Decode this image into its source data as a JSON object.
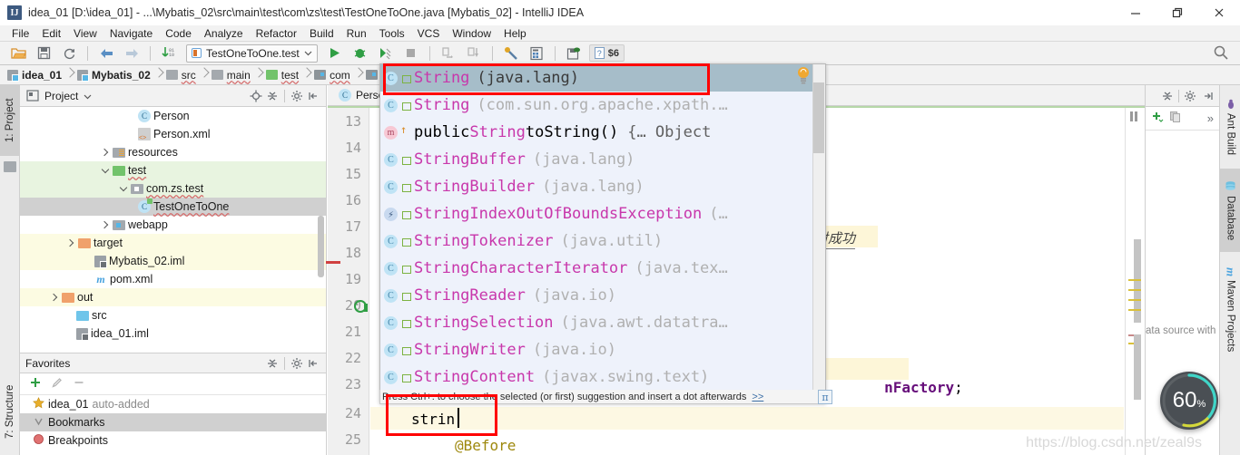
{
  "window": {
    "title": "idea_01 [D:\\idea_01] - ...\\Mybatis_02\\src\\main\\test\\com\\zs\\test\\TestOneToOne.java [Mybatis_02] - IntelliJ IDEA",
    "logo_text": "IJ",
    "minimize_label": "minimize",
    "maximize_label": "restore",
    "close_label": "close"
  },
  "menubar": {
    "items": [
      "File",
      "Edit",
      "View",
      "Navigate",
      "Code",
      "Analyze",
      "Refactor",
      "Build",
      "Run",
      "Tools",
      "VCS",
      "Window",
      "Help"
    ]
  },
  "toolbar": {
    "icons": [
      {
        "name": "open-project-icon"
      },
      {
        "name": "save-all-icon"
      },
      {
        "name": "sync-icon"
      },
      {
        "name": "back-icon"
      },
      {
        "name": "forward-icon"
      },
      {
        "name": "update-project-icon"
      }
    ],
    "run_config": "TestOneToOne.test",
    "run_icons": [
      {
        "name": "run-icon"
      },
      {
        "name": "debug-icon"
      },
      {
        "name": "run-with-coverage-icon"
      },
      {
        "name": "stop-icon"
      },
      {
        "name": "step-over-icon"
      },
      {
        "name": "step-into-icon"
      },
      {
        "name": "settings-wrench-icon"
      },
      {
        "name": "project-structure-icon"
      },
      {
        "name": "save-db-icon"
      }
    ],
    "help_badge": "$6",
    "search_label": "search-everywhere"
  },
  "navbar": {
    "crumbs": [
      {
        "label": "idea_01",
        "kind": "module",
        "bold": true,
        "spell": false
      },
      {
        "label": "Mybatis_02",
        "kind": "module",
        "bold": true,
        "spell": false
      },
      {
        "label": "src",
        "kind": "folder-gray",
        "bold": false,
        "spell": true
      },
      {
        "label": "main",
        "kind": "folder-gray",
        "bold": false,
        "spell": true
      },
      {
        "label": "test",
        "kind": "folder-green",
        "bold": false,
        "spell": true
      },
      {
        "label": "com",
        "kind": "folder-gray",
        "bold": false,
        "spell": true
      },
      {
        "label": "",
        "kind": "folder-blue",
        "bold": false,
        "spell": false
      }
    ]
  },
  "left_tabs": [
    {
      "label": "1: Project",
      "selected": true
    },
    {
      "label": "7: Structure",
      "selected": false
    }
  ],
  "right_tabs": [
    {
      "label": "Ant Build",
      "icon": "ant-icon",
      "selected": false
    },
    {
      "label": "Database",
      "icon": "database-icon",
      "selected": true
    },
    {
      "label": "Maven Projects",
      "icon": "maven-m-icon",
      "selected": false
    }
  ],
  "project_panel": {
    "title": "Project",
    "actions": [
      "locate-icon",
      "collapse-all-icon",
      "gear-icon",
      "hide-icon"
    ],
    "tree": [
      {
        "label": "Person",
        "icon": "class-icon",
        "indent": 7,
        "twist": "none",
        "row": "normal",
        "spell": false
      },
      {
        "label": "Person.xml",
        "icon": "xml-icon",
        "indent": 7,
        "twist": "none",
        "row": "normal",
        "spell": false
      },
      {
        "label": "resources",
        "icon": "resources-folder-icon",
        "indent": 4,
        "twist": "closed",
        "row": "normal",
        "spell": false
      },
      {
        "label": "test",
        "icon": "folder-green-icon",
        "indent": 4,
        "twist": "open",
        "row": "green",
        "spell": true
      },
      {
        "label": "com.zs.test",
        "icon": "package-icon",
        "indent": 5,
        "twist": "open",
        "row": "green",
        "spell": true
      },
      {
        "label": "TestOneToOne",
        "icon": "test-class-icon",
        "indent": 7,
        "twist": "none",
        "row": "selected",
        "spell": true
      },
      {
        "label": "webapp",
        "icon": "web-folder-icon",
        "indent": 4,
        "twist": "closed",
        "row": "normal",
        "spell": false
      },
      {
        "label": "target",
        "icon": "folder-orange-icon",
        "indent": 3,
        "twist": "closed",
        "row": "yellow",
        "spell": false
      },
      {
        "label": "Mybatis_02.iml",
        "icon": "iml-icon",
        "indent": 4,
        "twist": "none",
        "row": "yellow",
        "spell": false
      },
      {
        "label": "pom.xml",
        "icon": "maven-pom-icon",
        "indent": 4,
        "twist": "none",
        "row": "normal",
        "spell": false
      },
      {
        "label": "out",
        "icon": "folder-orange-icon",
        "indent": 2,
        "twist": "closed",
        "row": "yellow",
        "spell": false
      },
      {
        "label": "src",
        "icon": "folder-blue-icon",
        "indent": 3,
        "twist": "none",
        "row": "normal",
        "spell": false
      },
      {
        "label": "idea_01.iml",
        "icon": "iml-icon",
        "indent": 3,
        "twist": "none",
        "row": "normal",
        "spell": false
      }
    ]
  },
  "favorites_panel": {
    "title": "Favorites",
    "tools": [
      "add-icon",
      "edit-icon",
      "remove-icon"
    ],
    "actions": [
      "collapse-all-icon",
      "gear-icon",
      "hide-icon"
    ],
    "rows": [
      {
        "label": "idea_01",
        "suffix": "auto-added",
        "icon": "star-icon",
        "selected": false
      },
      {
        "label": "Bookmarks",
        "suffix": "",
        "icon": "bookmark-check-icon",
        "selected": true
      },
      {
        "label": "Breakpoints",
        "suffix": "",
        "icon": "breakpoint-icon",
        "selected": false
      }
    ]
  },
  "editor": {
    "tab_label": "Perso",
    "tab_icon": "class-icon",
    "line_numbers": [
      "13",
      "14",
      "15",
      "16",
      "17",
      "18",
      "19",
      "20",
      "21",
      "22",
      "23",
      "24",
      "25"
    ],
    "run_gutter_line": "20",
    "visible_code": [
      {
        "line": "17",
        "text": "射成功",
        "style": "cjk-highlight"
      },
      {
        "line": "22",
        "text": "nFactory;",
        "style": "purple-highlight"
      },
      {
        "line": "24",
        "text": "strin",
        "style": "plain"
      },
      {
        "line": "25",
        "text": "@Before",
        "style": "annotation"
      }
    ],
    "caret_text": "strin"
  },
  "autocomplete": {
    "hint": "Press Ctrl+. to choose the selected (or first) suggestion and insert a dot afterwards",
    "hint_link": ">>",
    "pi_badge": "π",
    "bulb_icon": "intention-bulb-icon",
    "items": [
      {
        "kind": "class",
        "sub": "lock",
        "name": "String",
        "pkg": "(java.lang)",
        "selected": true
      },
      {
        "kind": "class",
        "sub": "lock",
        "name": "String",
        "pkg": "(com.sun.org.apache.xpath.…",
        "selected": false
      },
      {
        "kind": "method",
        "sub": "over",
        "prefix": "public ",
        "name": "String",
        "suffix": " toString()",
        "tail": "{… Object",
        "selected": false
      },
      {
        "kind": "class-abs",
        "sub": "lock",
        "name": "StringBuffer",
        "pkg": "(java.lang)",
        "selected": false
      },
      {
        "kind": "class-abs",
        "sub": "lock",
        "name": "StringBuilder",
        "pkg": "(java.lang)",
        "selected": false
      },
      {
        "kind": "exception",
        "sub": "lock",
        "name": "StringIndexOutOfBoundsException",
        "pkg": "(…",
        "selected": false
      },
      {
        "kind": "class",
        "sub": "lock",
        "name": "StringTokenizer",
        "pkg": "(java.util)",
        "selected": false
      },
      {
        "kind": "class-abs",
        "sub": "lock",
        "name": "StringCharacterIterator",
        "pkg": "(java.tex…",
        "selected": false
      },
      {
        "kind": "class",
        "sub": "lock",
        "name": "StringReader",
        "pkg": "(java.io)",
        "selected": false
      },
      {
        "kind": "class",
        "sub": "lock",
        "name": "StringSelection",
        "pkg": "(java.awt.datatra…",
        "selected": false
      },
      {
        "kind": "class",
        "sub": "lock",
        "name": "StringWriter",
        "pkg": "(java.io)",
        "selected": false
      },
      {
        "kind": "class-abs",
        "sub": "lock",
        "name": "StringContent",
        "pkg": "(javax.swing.text)",
        "selected": false
      }
    ]
  },
  "right_panel": {
    "actions": [
      "collapse-all-icon",
      "gear-icon",
      "hide-icon"
    ],
    "tools": [
      "add-icon",
      "copy-icon",
      "more-icon"
    ],
    "note": "ata source with"
  },
  "progress": {
    "value": "60",
    "unit": "%"
  },
  "watermark": "https://blog.csdn.net/zeal9s",
  "colors": {
    "accent_red": "#ff0000",
    "selection_blue": "#a6bdc9",
    "popup_bg": "#eef2fb",
    "name_magenta": "#c837ab",
    "pkg_gray": "#b0b0b0",
    "green_folder": "#72c36b",
    "orange_folder": "#f0a16b"
  }
}
